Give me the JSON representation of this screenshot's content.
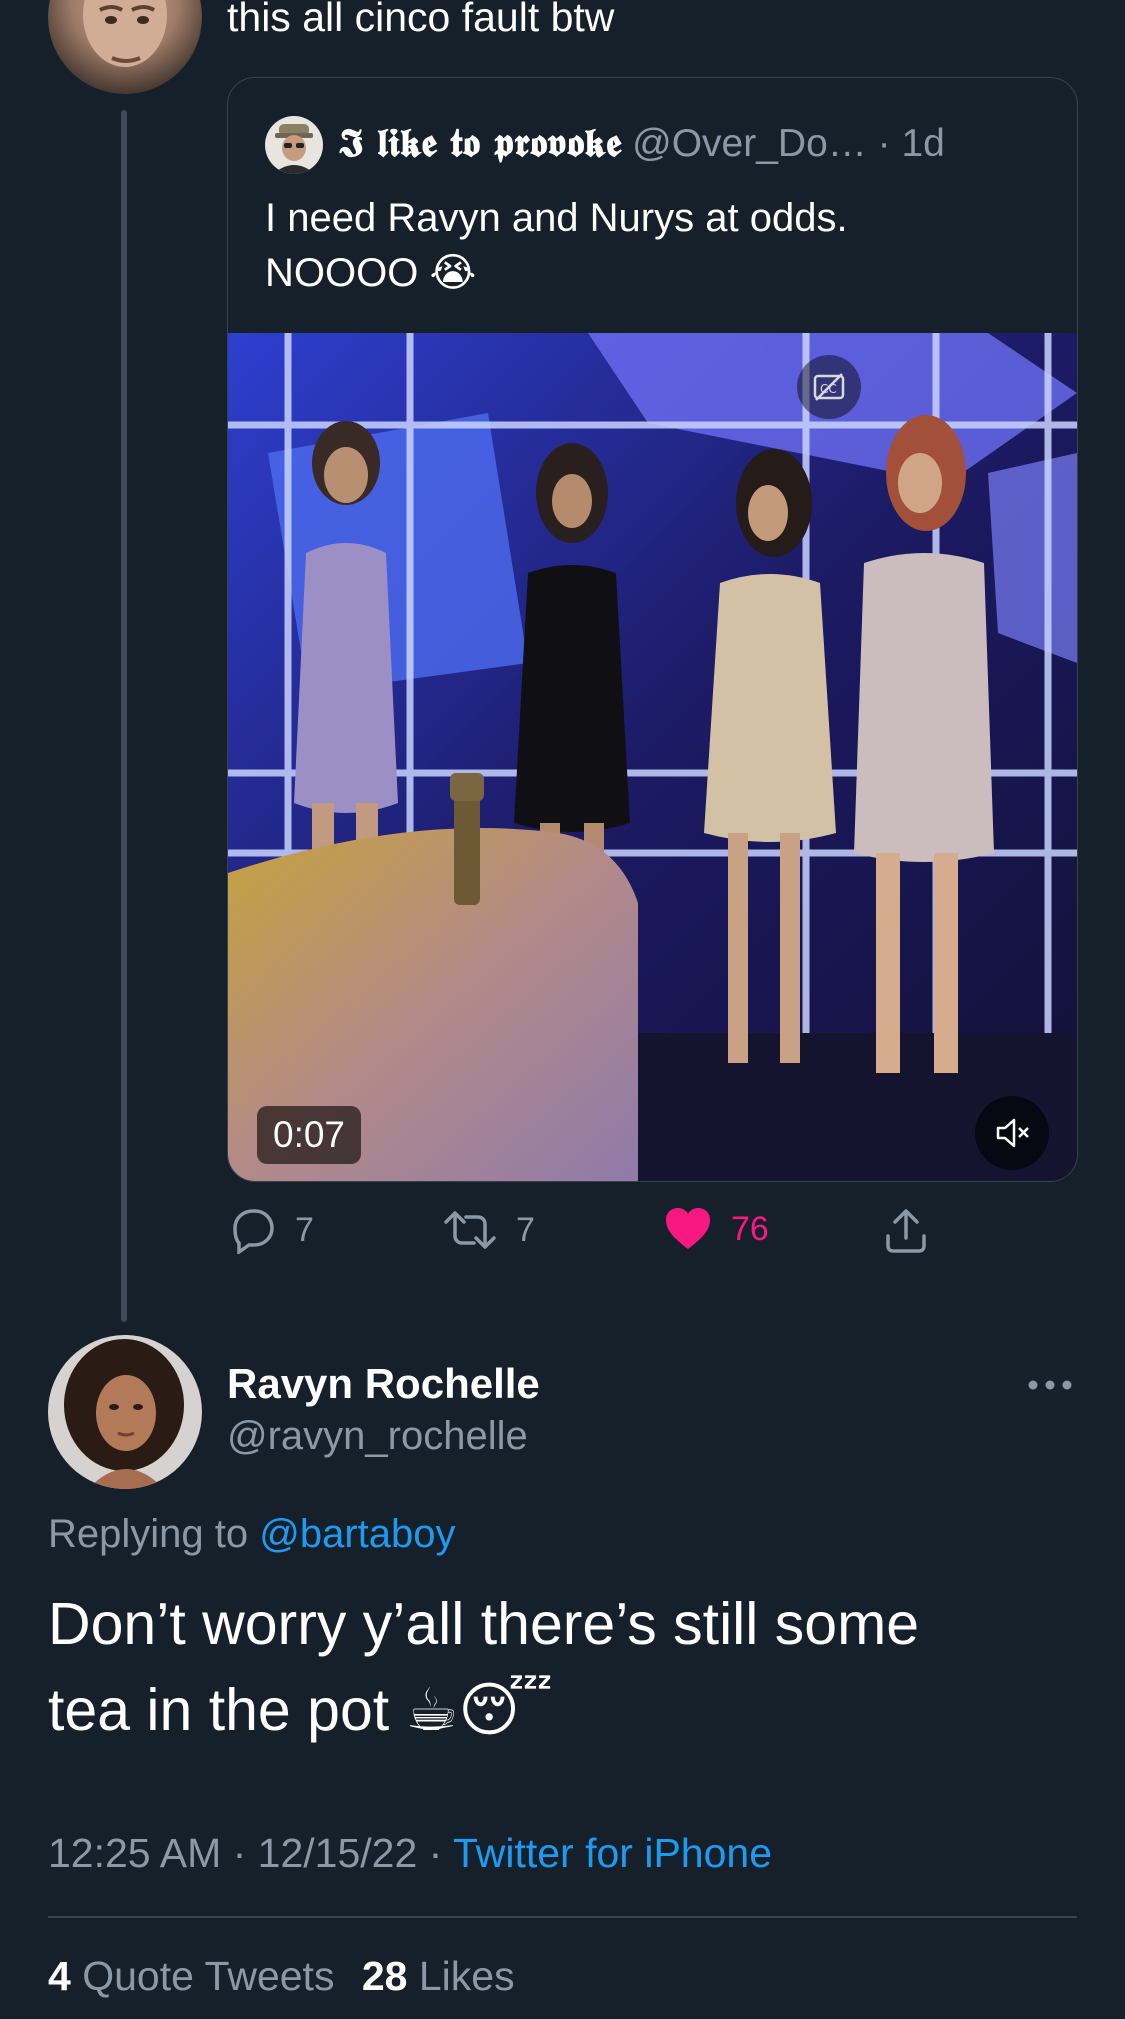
{
  "prev_tweet": {
    "text": "this all cinco fault btw"
  },
  "quoted_tweet": {
    "display_name": "𝕴 𝖑𝖎𝖐𝖊 𝖙𝖔 𝖕𝖗𝖔𝖛𝖔𝖐𝖊",
    "handle": "@Over_Do…",
    "separator": "·",
    "time": "1d",
    "line1": "I need Ravyn and Nurys at odds.",
    "line2": "NOOOO 😭",
    "video_duration": "0:07"
  },
  "actions": {
    "replies": "7",
    "retweets": "7",
    "likes": "76"
  },
  "main_tweet": {
    "display_name": "Ravyn Rochelle",
    "handle": "@ravyn_rochelle",
    "replying_prefix": "Replying to",
    "replying_to": "@bartaboy",
    "text_line1": "Don’t worry y’all there’s still some",
    "text_line2": "tea in the pot ☕😴",
    "timestamp": "12:25 AM · 12/15/22 ·",
    "source": "Twitter for iPhone"
  },
  "stats": {
    "quote_count": "4",
    "quote_label": "Quote Tweets",
    "like_count": "28",
    "like_label": "Likes"
  },
  "colors": {
    "background": "#15202b",
    "accent": "#1d9bf0",
    "like": "#f91880",
    "muted": "#8b98a5"
  }
}
